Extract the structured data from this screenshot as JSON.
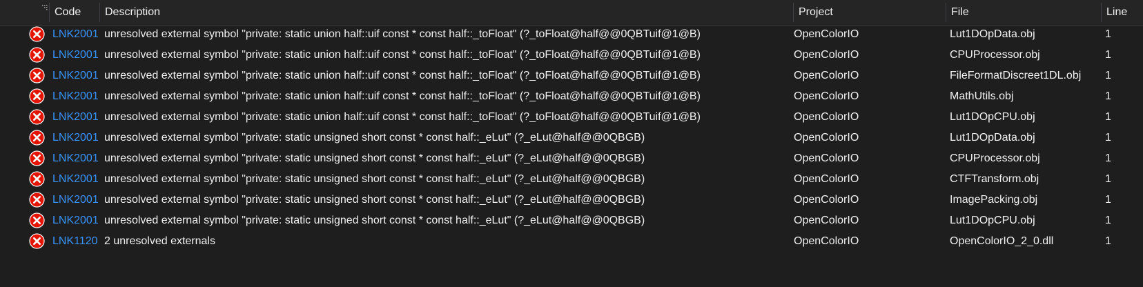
{
  "header": {
    "code": "Code",
    "description": "Description",
    "project": "Project",
    "file": "File",
    "line": "Line"
  },
  "colors": {
    "background": "#1e1e1e",
    "code_link": "#3794ff",
    "error_icon": "#e51400"
  },
  "rows": [
    {
      "icon": "error-icon",
      "code": "LNK2001",
      "description": "unresolved external symbol \"private: static union half::uif const * const half::_toFloat\" (?_toFloat@half@@0QBTuif@1@B)",
      "project": "OpenColorIO",
      "file": "Lut1DOpData.obj",
      "line": "1"
    },
    {
      "icon": "error-icon",
      "code": "LNK2001",
      "description": "unresolved external symbol \"private: static union half::uif const * const half::_toFloat\" (?_toFloat@half@@0QBTuif@1@B)",
      "project": "OpenColorIO",
      "file": "CPUProcessor.obj",
      "line": "1"
    },
    {
      "icon": "error-icon",
      "code": "LNK2001",
      "description": "unresolved external symbol \"private: static union half::uif const * const half::_toFloat\" (?_toFloat@half@@0QBTuif@1@B)",
      "project": "OpenColorIO",
      "file": "FileFormatDiscreet1DL.obj",
      "line": "1"
    },
    {
      "icon": "error-icon",
      "code": "LNK2001",
      "description": "unresolved external symbol \"private: static union half::uif const * const half::_toFloat\" (?_toFloat@half@@0QBTuif@1@B)",
      "project": "OpenColorIO",
      "file": "MathUtils.obj",
      "line": "1"
    },
    {
      "icon": "error-icon",
      "code": "LNK2001",
      "description": "unresolved external symbol \"private: static union half::uif const * const half::_toFloat\" (?_toFloat@half@@0QBTuif@1@B)",
      "project": "OpenColorIO",
      "file": "Lut1DOpCPU.obj",
      "line": "1"
    },
    {
      "icon": "error-icon",
      "code": "LNK2001",
      "description": "unresolved external symbol \"private: static unsigned short const * const half::_eLut\" (?_eLut@half@@0QBGB)",
      "project": "OpenColorIO",
      "file": "Lut1DOpData.obj",
      "line": "1"
    },
    {
      "icon": "error-icon",
      "code": "LNK2001",
      "description": "unresolved external symbol \"private: static unsigned short const * const half::_eLut\" (?_eLut@half@@0QBGB)",
      "project": "OpenColorIO",
      "file": "CPUProcessor.obj",
      "line": "1"
    },
    {
      "icon": "error-icon",
      "code": "LNK2001",
      "description": "unresolved external symbol \"private: static unsigned short const * const half::_eLut\" (?_eLut@half@@0QBGB)",
      "project": "OpenColorIO",
      "file": "CTFTransform.obj",
      "line": "1"
    },
    {
      "icon": "error-icon",
      "code": "LNK2001",
      "description": "unresolved external symbol \"private: static unsigned short const * const half::_eLut\" (?_eLut@half@@0QBGB)",
      "project": "OpenColorIO",
      "file": "ImagePacking.obj",
      "line": "1"
    },
    {
      "icon": "error-icon",
      "code": "LNK2001",
      "description": "unresolved external symbol \"private: static unsigned short const * const half::_eLut\" (?_eLut@half@@0QBGB)",
      "project": "OpenColorIO",
      "file": "Lut1DOpCPU.obj",
      "line": "1"
    },
    {
      "icon": "error-icon",
      "code": "LNK1120",
      "description": "2 unresolved externals",
      "project": "OpenColorIO",
      "file": "OpenColorIO_2_0.dll",
      "line": "1"
    }
  ]
}
